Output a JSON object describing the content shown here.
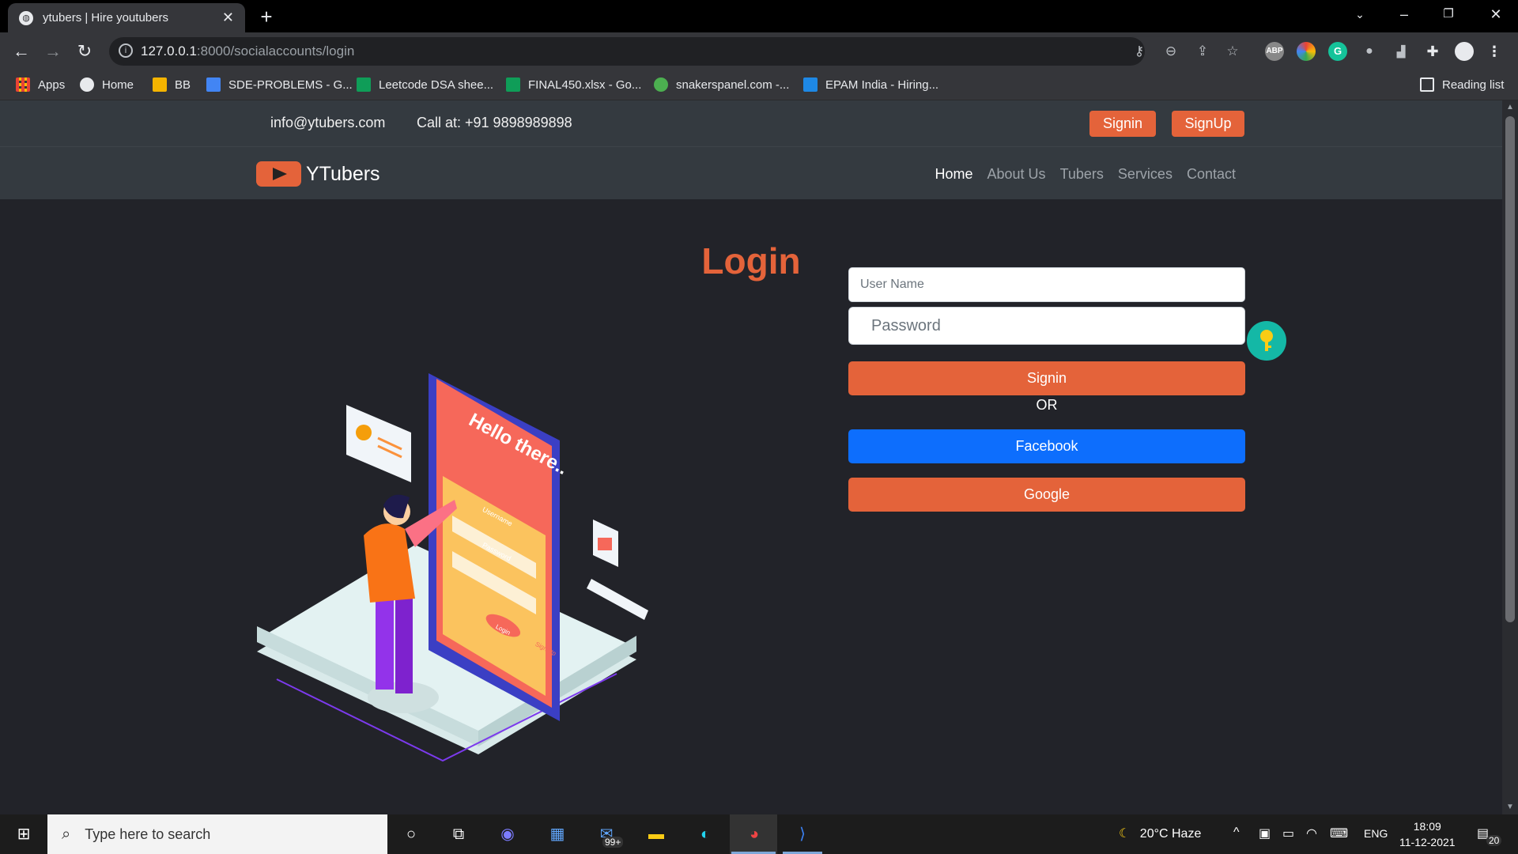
{
  "browser": {
    "tab_title": "ytubers | Hire youtubers",
    "url_host": "127.0.0.1",
    "url_path": ":8000/socialaccounts/login",
    "ext_abp": "ABP",
    "ext_g": "G",
    "bookmarks": [
      {
        "label": "Apps",
        "color": "#e8eaed"
      },
      {
        "label": "Home",
        "color": "#e8eaed"
      },
      {
        "label": "BB",
        "color": "#f4b400"
      },
      {
        "label": "SDE-PROBLEMS - G...",
        "color": "#4285f4"
      },
      {
        "label": "Leetcode DSA shee...",
        "color": "#0f9d58"
      },
      {
        "label": "FINAL450.xlsx - Go...",
        "color": "#0f9d58"
      },
      {
        "label": "snakerspanel.com -...",
        "color": "#4caf50"
      },
      {
        "label": "EPAM India - Hiring...",
        "color": "#1e88e5"
      }
    ],
    "reading_list": "Reading list"
  },
  "site": {
    "email": "info@ytubers.com",
    "phone": "Call at: +91 9898989898",
    "signin_top": "Signin",
    "signup_top": "SignUp",
    "brand": "YTubers",
    "nav": [
      "Home",
      "About Us",
      "Tubers",
      "Services",
      "Contact"
    ],
    "active_nav": "Home",
    "accent_color": "#e4633a"
  },
  "login": {
    "title": "Login",
    "username_placeholder": "User Name",
    "password_placeholder": "Password",
    "signin_button": "Signin",
    "or_text": "OR",
    "facebook_button": "Facebook",
    "google_button": "Google"
  },
  "illustration": {
    "phone_greeting": "Hello there..",
    "username_label": "Username",
    "password_label": "Password",
    "login_label": "Login",
    "signup_label": "Sign Up"
  },
  "taskbar": {
    "search_placeholder": "Type here to search",
    "mail_badge": "99+",
    "weather": "20°C  Haze",
    "language": "ENG",
    "time": "18:09",
    "date": "11-12-2021",
    "notifications": "20"
  }
}
